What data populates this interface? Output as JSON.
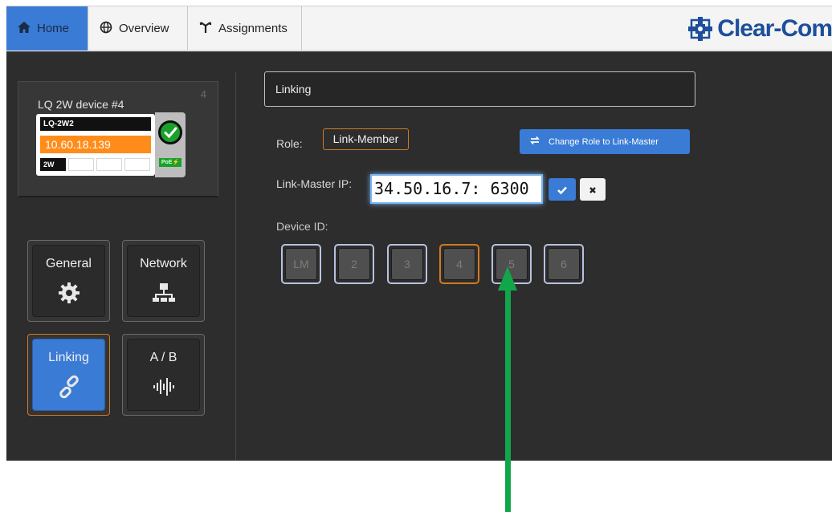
{
  "nav": {
    "tabs": [
      {
        "label": "Home",
        "icon": "home-icon",
        "active": true
      },
      {
        "label": "Overview",
        "icon": "globe-icon",
        "active": false
      },
      {
        "label": "Assignments",
        "icon": "assignments-icon",
        "active": false
      }
    ],
    "brand": "Clear-Com"
  },
  "device": {
    "name": "LQ 2W device #4",
    "number": "4",
    "model": "LQ-2W2",
    "ip": "10.60.18.139",
    "port_label": "2W",
    "status": "online",
    "poe_label": "PoE"
  },
  "menu": [
    {
      "label": "General",
      "icon": "gear-icon",
      "active": false
    },
    {
      "label": "Network",
      "icon": "network-icon",
      "active": false
    },
    {
      "label": "Linking",
      "icon": "link-icon",
      "active": true
    },
    {
      "label": "A / B",
      "icon": "audio-wave-icon",
      "active": false
    }
  ],
  "linking": {
    "header": "Linking",
    "role_label": "Role:",
    "role_value": "Link-Member",
    "change_role_button": "Change Role to Link-Master",
    "link_master_ip_label": "Link-Master IP:",
    "link_master_ip_value": "34.50.16.7: 6300",
    "device_id_label": "Device ID:",
    "device_ids": [
      "LM",
      "2",
      "3",
      "4",
      "5",
      "6"
    ],
    "selected_device_id": "4"
  },
  "colors": {
    "accent_blue": "#3a7bd5",
    "selected_orange": "#d07a22",
    "ip_orange": "#ff8c1a",
    "status_green": "#1aa12c",
    "annotation_arrow": "#12a64a"
  }
}
